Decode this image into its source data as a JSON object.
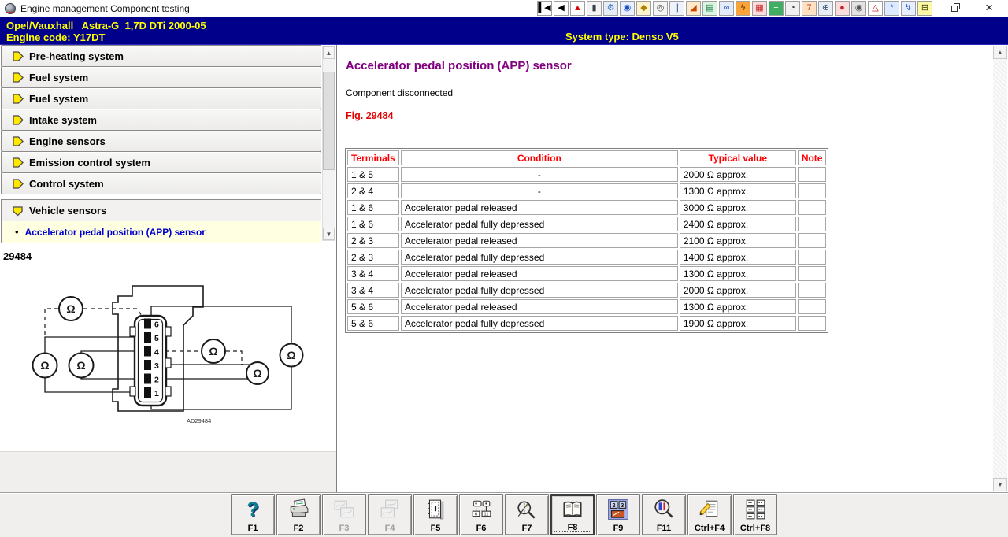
{
  "window": {
    "title": "Engine management Component testing",
    "close_glyph": "×"
  },
  "header": {
    "vehicle_line1": "Opel/Vauxhall   Astra-G  1,7D DTi 2000-05",
    "vehicle_line2": "Engine code: Y17DT",
    "system_type": "System type: Denso V5",
    "bg_color": "#00008b",
    "text_color": "#ffff00"
  },
  "toolbar_top": {
    "icons": [
      {
        "name": "go-first-icon",
        "glyph": "▌◀",
        "fg": "#000000",
        "bg": "#ffffff"
      },
      {
        "name": "go-back-icon",
        "glyph": "◀",
        "fg": "#000000",
        "bg": "#ffffff"
      },
      {
        "name": "warning-icon",
        "glyph": "▲",
        "fg": "#dd0000",
        "bg": "#ffffff"
      },
      {
        "name": "technical-data-icon",
        "glyph": "▮",
        "fg": "#3b3b46",
        "bg": "#f3f3f3"
      },
      {
        "name": "repair-tools-icon",
        "glyph": "⚙",
        "fg": "#4477bb",
        "bg": "#e4ecf7"
      },
      {
        "name": "engine-icon",
        "glyph": "◉",
        "fg": "#1d4fc4",
        "bg": "#e8f0ff"
      },
      {
        "name": "service-indicator-icon",
        "glyph": "◆",
        "fg": "#b08400",
        "bg": "#fdf3cf"
      },
      {
        "name": "wheels-tyres-icon",
        "glyph": "◎",
        "fg": "#4c4c4c",
        "bg": "#f4f4f4"
      },
      {
        "name": "suspension-icon",
        "glyph": "∥",
        "fg": "#3a4a80",
        "bg": "#eef2fa"
      },
      {
        "name": "wheel-alignment-icon",
        "glyph": "◢",
        "fg": "#cc4400",
        "bg": "#ffeacc"
      },
      {
        "name": "vehicle-lift-icon",
        "glyph": "▤",
        "fg": "#0a7a40",
        "bg": "#ddf4e2"
      },
      {
        "name": "towing-icon",
        "glyph": "∞",
        "fg": "#2a5ac0",
        "bg": "#e4ecfa"
      },
      {
        "name": "spark-plug-icon",
        "glyph": "ϟ",
        "fg": "#6b3c00",
        "bg": "#f9a33a"
      },
      {
        "name": "engine-management-icon",
        "glyph": "▦",
        "fg": "#c42222",
        "bg": "#fbdcdc"
      },
      {
        "name": "copier-icon",
        "glyph": "≡",
        "fg": "#ffffff",
        "bg": "#3fae62"
      },
      {
        "name": "timing-belt-icon",
        "glyph": "◔",
        "fg": "#333333",
        "bg": "#f1f1f1"
      },
      {
        "name": "timing-data-icon",
        "glyph": "7",
        "fg": "#cc3300",
        "bg": "#ffe2c4"
      },
      {
        "name": "fuel-injection-icon",
        "glyph": "⊕",
        "fg": "#39506e",
        "bg": "#e8eef6"
      },
      {
        "name": "airbag-icon",
        "glyph": "●",
        "fg": "#c42222",
        "bg": "#fbdcdc"
      },
      {
        "name": "abs-icon",
        "glyph": "◉",
        "fg": "#555555",
        "bg": "#e3e3e3"
      },
      {
        "name": "mot-test-icon",
        "glyph": "△",
        "fg": "#cc0000",
        "bg": "#ffffff"
      },
      {
        "name": "air-conditioning-icon",
        "glyph": "*",
        "fg": "#2a5ac0",
        "bg": "#ddeaff"
      },
      {
        "name": "electrics-icon",
        "glyph": "↯",
        "fg": "#2a5ac0",
        "bg": "#e6eeff"
      },
      {
        "name": "battery-icon",
        "glyph": "⊟",
        "fg": "#444400",
        "bg": "#fef9a7"
      }
    ]
  },
  "sidebar": {
    "items": [
      {
        "label": "Pre-heating system"
      },
      {
        "label": "Fuel system"
      },
      {
        "label": "Fuel system"
      },
      {
        "label": "Intake system"
      },
      {
        "label": "Engine sensors"
      },
      {
        "label": "Emission control system"
      },
      {
        "label": "Control system"
      }
    ],
    "expanded_item": {
      "label": "Vehicle sensors"
    },
    "sub_item": {
      "bullet": "•",
      "label": "Accelerator pedal position (APP) sensor"
    },
    "scroll": {
      "up_glyph": "▲",
      "down_glyph": "▼"
    }
  },
  "figure": {
    "number": "29484",
    "code_label": "AD29484",
    "ohm_symbol": "Ω",
    "pin_numbers": [
      "6",
      "5",
      "4",
      "3",
      "2",
      "1"
    ]
  },
  "content": {
    "title": "Accelerator pedal position (APP) sensor",
    "subtitle": "Component disconnected",
    "figure_ref": "Fig. 29484",
    "title_color": "#800080",
    "figure_ref_color": "#e60000",
    "table": {
      "header_color": "#ff0000",
      "headers": [
        "Terminals",
        "Condition",
        "Typical value",
        "Note"
      ],
      "rows": [
        [
          "1 & 5",
          "-",
          "2000 Ω approx.",
          ""
        ],
        [
          "2 & 4",
          "-",
          "1300 Ω approx.",
          ""
        ],
        [
          "1 & 6",
          "Accelerator pedal released",
          "3000 Ω approx.",
          ""
        ],
        [
          "1 & 6",
          "Accelerator pedal fully depressed",
          "2400 Ω approx.",
          ""
        ],
        [
          "2 & 3",
          "Accelerator pedal released",
          "2100 Ω approx.",
          ""
        ],
        [
          "2 & 3",
          "Accelerator pedal fully depressed",
          "1400 Ω approx.",
          ""
        ],
        [
          "3 & 4",
          "Accelerator pedal released",
          "1300 Ω approx.",
          ""
        ],
        [
          "3 & 4",
          "Accelerator pedal fully depressed",
          "2000 Ω approx.",
          ""
        ],
        [
          "5 & 6",
          "Accelerator pedal released",
          "1300 Ω approx.",
          ""
        ],
        [
          "5 & 6",
          "Accelerator pedal fully depressed",
          "1900 Ω approx.",
          ""
        ]
      ]
    },
    "scroll": {
      "up_glyph": "▲",
      "down_glyph": "▼"
    }
  },
  "toolbar_bottom": {
    "buttons": [
      {
        "label": "F1",
        "icon": "help-icon",
        "enabled": true,
        "active": false
      },
      {
        "label": "F2",
        "icon": "print-icon",
        "enabled": true,
        "active": false
      },
      {
        "label": "F3",
        "icon": "pictures-icon",
        "enabled": false,
        "active": false
      },
      {
        "label": "F4",
        "icon": "pictures-alt-icon",
        "enabled": false,
        "active": false
      },
      {
        "label": "F5",
        "icon": "component-pinout-icon",
        "enabled": true,
        "active": false
      },
      {
        "label": "F6",
        "icon": "connector-views-icon",
        "enabled": true,
        "active": false
      },
      {
        "label": "F7",
        "icon": "locate-magnifier-icon",
        "enabled": true,
        "active": false
      },
      {
        "label": "F8",
        "icon": "manual-book-icon",
        "enabled": true,
        "active": true
      },
      {
        "label": "F9",
        "icon": "component-location-icon",
        "enabled": true,
        "active": false
      },
      {
        "label": "F11",
        "icon": "search-magnifier-icon",
        "enabled": true,
        "active": false
      },
      {
        "label": "Ctrl+F4",
        "icon": "notes-pencil-icon",
        "enabled": true,
        "active": false
      },
      {
        "label": "Ctrl+F8",
        "icon": "test-list-icon",
        "enabled": true,
        "active": false
      }
    ]
  }
}
